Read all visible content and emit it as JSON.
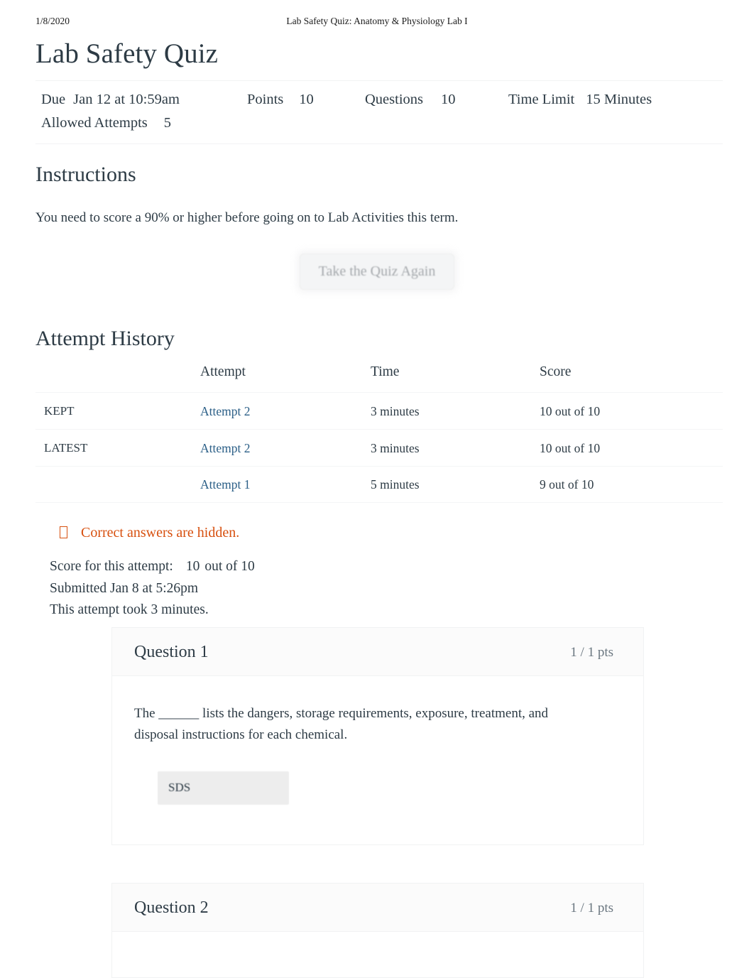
{
  "print_header": {
    "date": "1/8/2020",
    "document_title": "Lab Safety Quiz: Anatomy & Physiology Lab I"
  },
  "quiz": {
    "title": "Lab Safety Quiz",
    "details": [
      {
        "label": "Due",
        "value": "Jan 12 at 10:59am"
      },
      {
        "label": "Points",
        "value": "10"
      },
      {
        "label": "Questions",
        "value": "10"
      },
      {
        "label": "Time Limit",
        "value": "15 Minutes"
      },
      {
        "label": "Allowed Attempts",
        "value": "5"
      }
    ]
  },
  "instructions": {
    "heading": "Instructions",
    "body": "You need to score a 90% or higher before going on to Lab Activities this term.",
    "retake_button": "Take the Quiz Again"
  },
  "attempt_history": {
    "heading": "Attempt History",
    "columns": {
      "tag": "",
      "attempt": "Attempt",
      "time": "Time",
      "score": "Score"
    },
    "rows": [
      {
        "tag": "KEPT",
        "attempt": "Attempt 2",
        "time": "3 minutes",
        "score": "10 out of 10"
      },
      {
        "tag": "LATEST",
        "attempt": "Attempt 2",
        "time": "3 minutes",
        "score": "10 out of 10"
      },
      {
        "tag": "",
        "attempt": "Attempt 1",
        "time": "5 minutes",
        "score": "9 out of 10"
      }
    ]
  },
  "notice": {
    "icon": "missing-glyph-box-icon",
    "text": "Correct answers are hidden."
  },
  "attempt_summary": {
    "score_label": "Score for this attempt:",
    "score_value": "10",
    "score_outof": "out of 10",
    "submitted": "Submitted Jan 8 at 5:26pm",
    "duration": "This attempt took 3 minutes."
  },
  "questions": [
    {
      "name": "Question 1",
      "points": "1 / 1 pts",
      "text": "The ______ lists the dangers, storage requirements, exposure, treatment, and disposal instructions for each chemical.",
      "answer": "SDS"
    },
    {
      "name": "Question 2",
      "points": "1 / 1 pts",
      "text": "",
      "answer": ""
    }
  ],
  "colors": {
    "link": "#2b5f87",
    "notice": "#d7500f",
    "text": "#2d3b45",
    "answer_bg": "#ededed",
    "card_header_bg": "#fbfbfb"
  }
}
